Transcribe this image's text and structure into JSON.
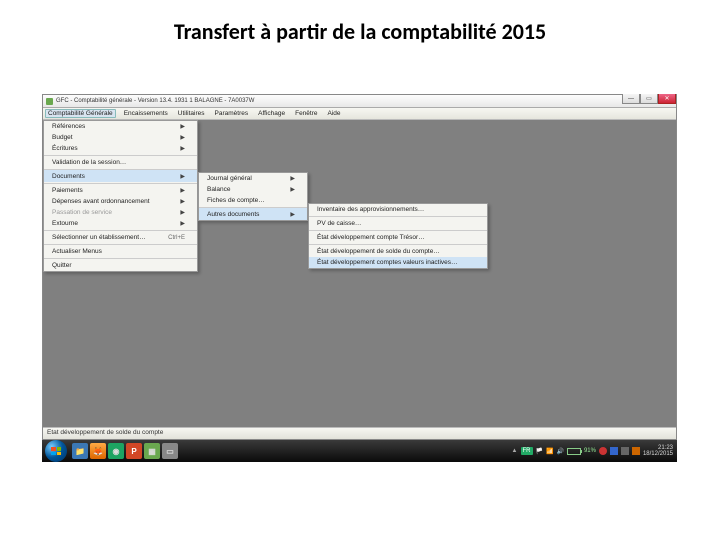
{
  "slide": {
    "title": "Transfert à partir de la comptabilité 2015"
  },
  "window": {
    "title": "GFC - Comptabilité générale - Version 13.4.  1931 1  BALAGNE - 7A0037W",
    "menubar": [
      "Comptabilité Générale",
      "Encaissements",
      "Utilitaires",
      "Paramètres",
      "Affichage",
      "Fenêtre",
      "Aide"
    ]
  },
  "menu1": {
    "items": [
      {
        "label": "Références",
        "arrow": true
      },
      {
        "label": "Budget",
        "arrow": true
      },
      {
        "label": "Écritures",
        "arrow": true
      },
      {
        "label": "Validation de la session…",
        "sep": true
      },
      {
        "label": "Documents",
        "arrow": true,
        "hover": true,
        "sep": true
      },
      {
        "label": "Paiements",
        "arrow": true,
        "sep": true
      },
      {
        "label": "Dépenses avant ordonnancement",
        "arrow": true
      },
      {
        "label": "Passation de service",
        "arrow": true,
        "disabled": true
      },
      {
        "label": "Extourne",
        "arrow": true
      },
      {
        "label": "Sélectionner un établissement…",
        "shortcut": "Ctrl+E",
        "sep": true
      },
      {
        "label": "Actualiser Menus",
        "sep": true
      },
      {
        "label": "Quitter",
        "sep": true
      }
    ]
  },
  "menu2": {
    "items": [
      {
        "label": "Journal général",
        "arrow": true
      },
      {
        "label": "Balance",
        "arrow": true
      },
      {
        "label": "Fiches de compte…"
      },
      {
        "label": "Autres documents",
        "arrow": true,
        "hover": true,
        "sep": true
      }
    ]
  },
  "menu3": {
    "items": [
      {
        "label": "Inventaire des approvisionnements…"
      },
      {
        "label": "PV de caisse…",
        "sep": true
      },
      {
        "label": "État développement compte Trésor…",
        "sep": true
      },
      {
        "label": "État développement de solde du compte…",
        "sep": true
      },
      {
        "label": "État développement comptes valeurs inactives…",
        "hover": true
      }
    ]
  },
  "statusbar": {
    "text": "Etat développement de solde du compte"
  },
  "taskbar": {
    "lang": "FR",
    "battery_pct": "91%",
    "time": "21:23",
    "date": "18/12/2015"
  }
}
